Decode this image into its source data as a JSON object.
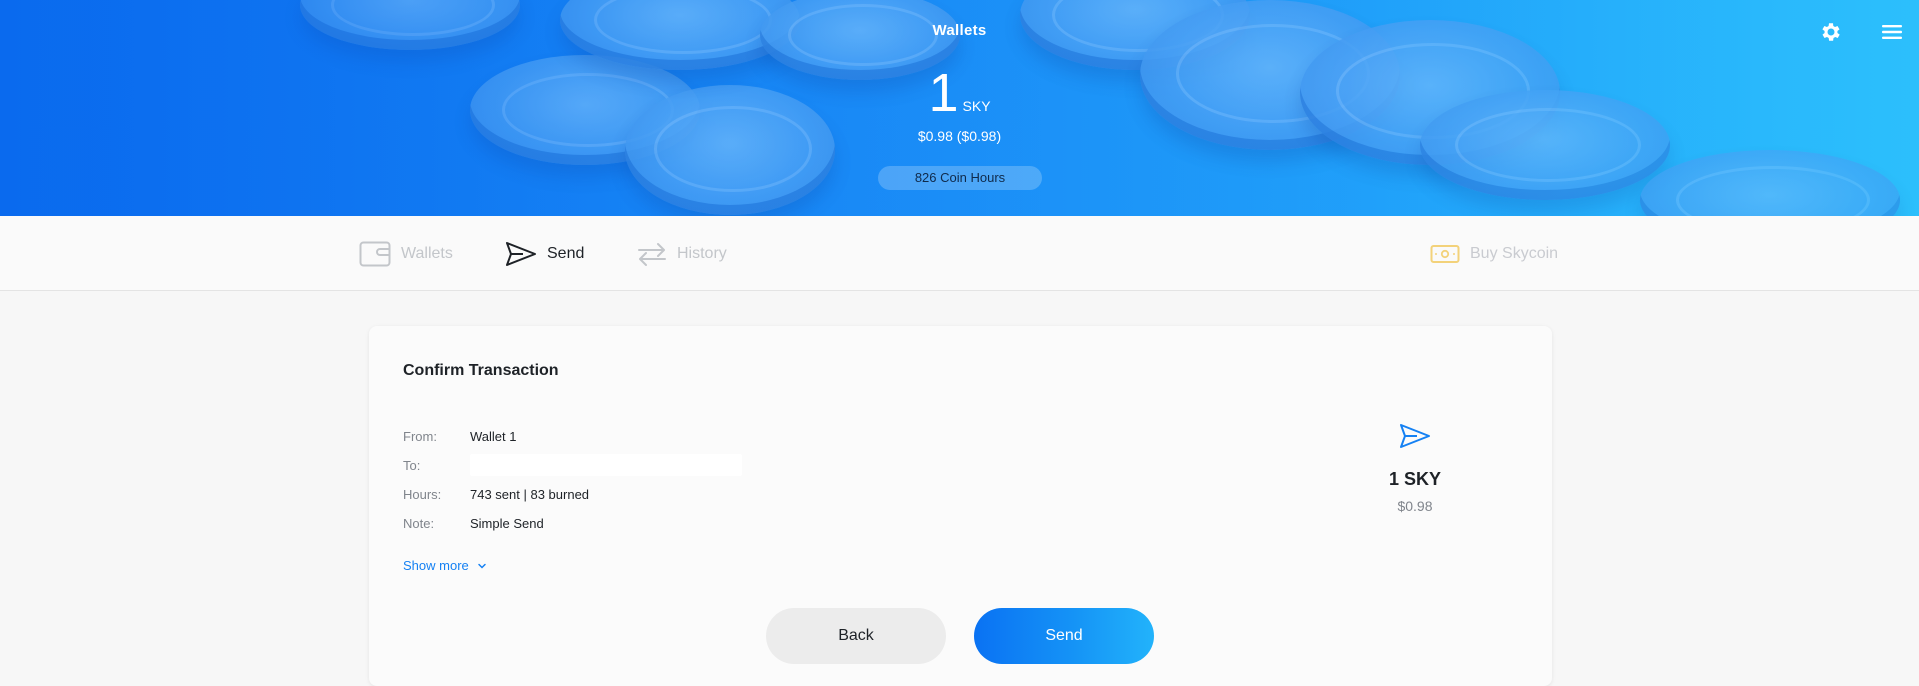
{
  "header": {
    "title": "Wallets",
    "balance_amount": "1",
    "balance_unit": "SKY",
    "balance_usd": "$0.98 ($0.98)",
    "coin_hours": "826 Coin Hours",
    "settings_icon": "gear-icon",
    "menu_icon": "hamburger-menu-icon"
  },
  "nav": {
    "items": [
      {
        "label": "Wallets",
        "icon": "wallet-icon",
        "active": false
      },
      {
        "label": "Send",
        "icon": "paper-plane-icon",
        "active": true
      },
      {
        "label": "History",
        "icon": "transfer-arrows-icon",
        "active": false
      }
    ],
    "buy": {
      "label": "Buy Skycoin",
      "icon": "banknote-icon"
    }
  },
  "confirm": {
    "title": "Confirm Transaction",
    "rows": [
      {
        "label": "From:",
        "value": "Wallet 1"
      },
      {
        "label": "To:",
        "value": ""
      },
      {
        "label": "Hours:",
        "value": "743 sent | 83 burned"
      },
      {
        "label": "Note:",
        "value": "Simple Send"
      }
    ],
    "show_more": "Show more",
    "summary": {
      "amount": "1 SKY",
      "usd": "$0.98",
      "icon": "paper-plane-icon"
    },
    "back_label": "Back",
    "send_label": "Send"
  },
  "colors": {
    "accent": "#1581f3",
    "header_start": "#0a6ff0",
    "header_end": "#2ec0fc",
    "buy_icon": "#f3d27a"
  }
}
